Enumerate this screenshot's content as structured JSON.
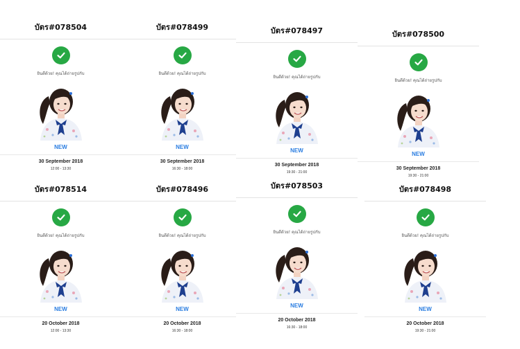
{
  "cards": [
    {
      "title": "บัตร#078504",
      "message": "ยินดีด้วย! คุณได้ถ่ายรูปกับ",
      "status": "NEW",
      "date": "30 September 2018",
      "time": "12:00 - 13:30"
    },
    {
      "title": "บัตร#078499",
      "message": "ยินดีด้วย! คุณได้ถ่ายรูปกับ",
      "status": "NEW",
      "date": "30 September 2018",
      "time": "16:30 - 18:00"
    },
    {
      "title": "บัตร#078497",
      "message": "ยินดีด้วย! คุณได้ถ่ายรูปกับ",
      "status": "NEW",
      "date": "30 September 2018",
      "time": "19:30 - 21:00"
    },
    {
      "title": "บัตร#078500",
      "message": "ยินดีด้วย! คุณได้ถ่ายรูปกับ",
      "status": "NEW",
      "date": "30 September 2018",
      "time": "19:30 - 21:00"
    },
    {
      "title": "บัตร#078514",
      "message": "ยินดีด้วย! คุณได้ถ่ายรูปกับ",
      "status": "NEW",
      "date": "20 October 2018",
      "time": "12:00 - 13:30"
    },
    {
      "title": "บัตร#078496",
      "message": "ยินดีด้วย! คุณได้ถ่ายรูปกับ",
      "status": "NEW",
      "date": "20 October 2018",
      "time": "16:30 - 18:00"
    },
    {
      "title": "บัตร#078503",
      "message": "ยินดีด้วย! คุณได้ถ่ายรูปกับ",
      "status": "NEW",
      "date": "20 October 2018",
      "time": "16:30 - 18:00"
    },
    {
      "title": "บัตร#078498",
      "message": "ยินดีด้วย! คุณได้ถ่ายรูปกับ",
      "status": "NEW",
      "date": "20 October 2018",
      "time": "19:30 - 21:00"
    }
  ],
  "colors": {
    "check": "#27a844",
    "status": "#2a7de1"
  },
  "icons": {
    "check": "check-icon",
    "photo": "member-photo"
  }
}
